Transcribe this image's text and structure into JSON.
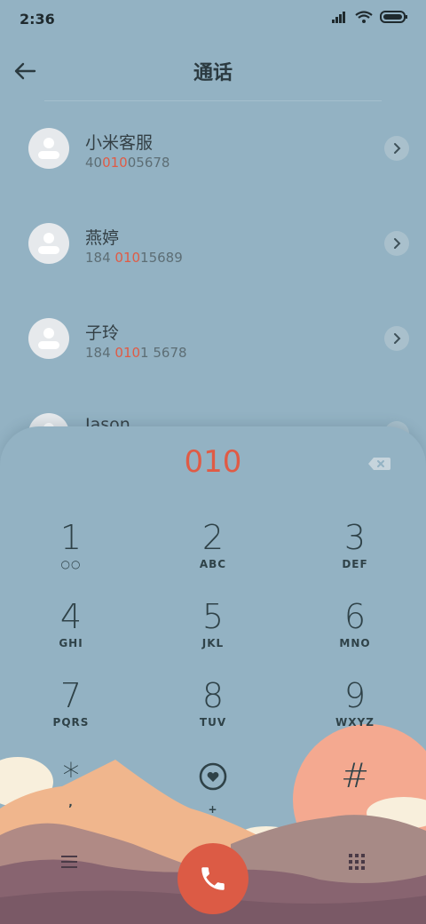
{
  "status": {
    "time": "2:36"
  },
  "header": {
    "title": "通话"
  },
  "contacts": [
    {
      "name": "小米客服",
      "number_pre": "40",
      "number_hl": "010",
      "number_post": "05678"
    },
    {
      "name": "燕婷",
      "number_pre": "184 ",
      "number_hl": "010",
      "number_post": "15689"
    },
    {
      "name": "子玲",
      "number_pre": "184 ",
      "number_hl": "010",
      "number_post": "1 5678"
    },
    {
      "name": "Jason",
      "number_pre": "",
      "number_hl": "",
      "number_post": ""
    }
  ],
  "dialer": {
    "input": "010",
    "keys": [
      {
        "digit": "1",
        "letters": "○○"
      },
      {
        "digit": "2",
        "letters": "ABC"
      },
      {
        "digit": "3",
        "letters": "DEF"
      },
      {
        "digit": "4",
        "letters": "GHI"
      },
      {
        "digit": "5",
        "letters": "JKL"
      },
      {
        "digit": "6",
        "letters": "MNO"
      },
      {
        "digit": "7",
        "letters": "PQRS"
      },
      {
        "digit": "8",
        "letters": "TUV"
      },
      {
        "digit": "9",
        "letters": "WXYZ"
      },
      {
        "digit": "*",
        "letters": ","
      },
      {
        "digit": "♡",
        "letters": "+"
      },
      {
        "digit": "#",
        "letters": ""
      }
    ]
  },
  "icons": {
    "back": "arrow-left-icon",
    "chevron": "chevron-right-icon",
    "backspace": "backspace-icon",
    "menu": "menu-icon",
    "call": "phone-icon",
    "keypad": "keypad-icon"
  },
  "colors": {
    "background": "#93b2c3",
    "accent": "#e05b45",
    "call_button": "#dc5b45",
    "sun": "#f4a990"
  }
}
